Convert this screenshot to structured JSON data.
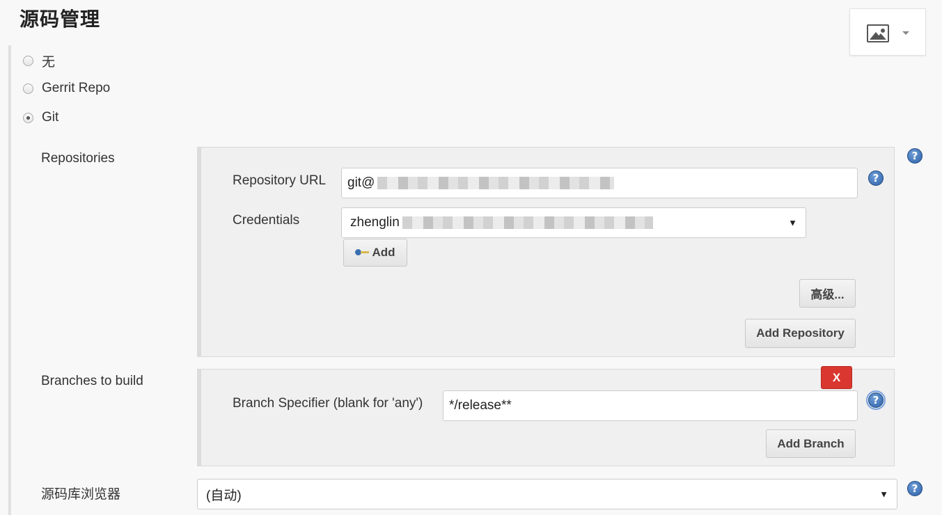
{
  "section": {
    "title": "源码管理"
  },
  "image_widget": {
    "icon": "image-icon",
    "caret": "chevron-down-icon"
  },
  "scm_options": [
    {
      "label": "无",
      "checked": false
    },
    {
      "label": "Gerrit Repo",
      "checked": false
    },
    {
      "label": "Git",
      "checked": true
    }
  ],
  "repositories": {
    "label": "Repositories",
    "url_label": "Repository URL",
    "url_value": "git@",
    "credentials_label": "Credentials",
    "credentials_value": "zhenglin",
    "add_label": "Add",
    "advanced_label": "高级...",
    "add_repository_label": "Add Repository",
    "help_icon": "?"
  },
  "branches": {
    "label": "Branches to build",
    "delete_label": "X",
    "specifier_label": "Branch Specifier (blank for 'any')",
    "specifier_value": "*/release**",
    "add_branch_label": "Add Branch",
    "help_icon": "?"
  },
  "browser": {
    "label": "源码库浏览器",
    "value": "(自动)",
    "help_icon": "?"
  },
  "colors": {
    "delete": "#d9372f",
    "help": "#2d5fa6"
  }
}
